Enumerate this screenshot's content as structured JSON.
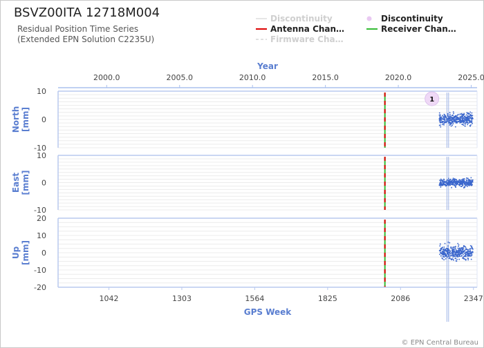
{
  "header": {
    "title": "BSVZ00ITA 12718M004",
    "subtitle_line1": "Residual Position Time Series",
    "subtitle_line2": "(Extended EPN Solution C2235U)"
  },
  "legend": [
    {
      "label": "Discontinuity",
      "symbol": "line",
      "color": "#e6e6e6",
      "dimmed": true
    },
    {
      "label": "Discontinuity",
      "symbol": "circle",
      "color": "#e9c9f2",
      "dimmed": false
    },
    {
      "label": "Antenna Chan…",
      "symbol": "line",
      "color": "#dd0000",
      "dimmed": false
    },
    {
      "label": "Receiver Chan…",
      "symbol": "line",
      "color": "#33bb33",
      "dimmed": false
    },
    {
      "label": "Firmware Cha…",
      "symbol": "dashed",
      "color": "#e0e0e0",
      "dimmed": true
    }
  ],
  "credit": "© EPN Central Bureau",
  "chart_data": {
    "type": "scatter",
    "x_label": "GPS Week",
    "x_ticks": [
      1042,
      1303,
      1564,
      1825,
      2086,
      2347
    ],
    "x_range": [
      860,
      2360
    ],
    "top_axis_label": "Year",
    "top_ticks": [
      "2000.0",
      "2005.0",
      "2010.0",
      "2015.0",
      "2020.0",
      "2025.0"
    ],
    "top_tick_weeks": [
      1034,
      1295,
      1556,
      1817,
      2078,
      2339
    ],
    "event_week": 2030,
    "discontinuity_marker": {
      "label": "1",
      "week": 2233,
      "panel": "North"
    },
    "data_span_weeks": [
      2225,
      2345
    ],
    "point_color": "#3a66cc",
    "panels": [
      {
        "name": "North",
        "label": "North",
        "unit": "[mm]",
        "ylim": [
          -10,
          10
        ],
        "yticks": [
          10,
          0,
          -10
        ],
        "series_center": 0,
        "series_spread": 2.5
      },
      {
        "name": "East",
        "label": "East",
        "unit": "[mm]",
        "ylim": [
          -10,
          10
        ],
        "yticks": [
          10,
          0,
          -10
        ],
        "series_center": 0,
        "series_spread": 1.8
      },
      {
        "name": "Up",
        "label": "Up",
        "unit": "[mm]",
        "ylim": [
          -20,
          20
        ],
        "yticks": [
          20,
          10,
          0,
          -10,
          -20
        ],
        "series_center": 0,
        "series_spread": 5
      }
    ]
  }
}
